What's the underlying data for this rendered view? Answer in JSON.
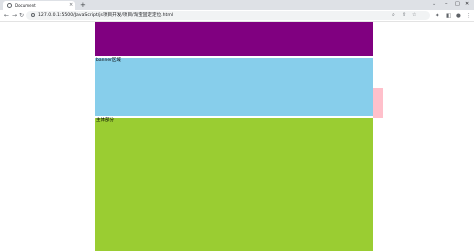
{
  "browser": {
    "tab_title": "Document",
    "tab_close": "×",
    "new_tab": "+",
    "url": "127.0.0.1:5500/JavaScript/js项目开发/项目/淘宝固定定位.html",
    "icons": [
      "favicon-icon",
      "close-icon",
      "new-tab-icon",
      "tab-search-icon",
      "minimize-icon",
      "maximize-icon",
      "close-window-icon",
      "back-icon",
      "forward-icon",
      "reload-icon",
      "site-info-icon",
      "zoom-icon",
      "share-icon",
      "bookmark-star-icon",
      "extensions-icon",
      "sidebar-icon",
      "profile-icon",
      "menu-icon"
    ]
  },
  "page": {
    "banner_label": "banner区域",
    "main_label": "主体部分",
    "colors": {
      "header": "#800080",
      "banner": "#87ceeb",
      "main": "#9acd32",
      "side": "#ffc0cb"
    }
  }
}
